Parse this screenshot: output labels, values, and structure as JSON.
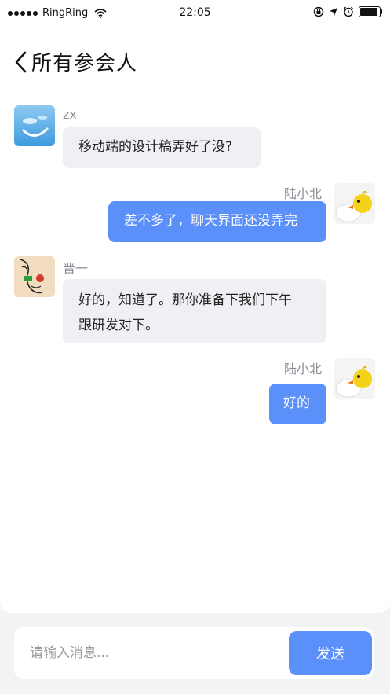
{
  "status_bar": {
    "carrier": "RingRing",
    "time": "22:05",
    "icons": [
      "signal-dots-icon",
      "wifi-icon",
      "rotation-lock-icon",
      "location-arrow-icon",
      "alarm-icon",
      "battery-icon"
    ]
  },
  "header": {
    "back_icon": "chevron-left-icon",
    "title": "所有参会人"
  },
  "messages": [
    {
      "sender": "zx",
      "direction": "incoming",
      "text": "移动端的设计稿弄好了没?",
      "avatar": "sky-smile-avatar"
    },
    {
      "sender": "陆小北",
      "direction": "outgoing",
      "text": "差不多了，聊天界面还没弄完",
      "avatar": "chick-avatar"
    },
    {
      "sender": "晋一",
      "direction": "incoming",
      "text_line1": "好的，知道了。那你准备下我们下午",
      "text_line2": "跟研发对下。",
      "avatar": "sketch-face-avatar"
    },
    {
      "sender": "陆小北",
      "direction": "outgoing",
      "text": "好的",
      "avatar": "chick-avatar"
    }
  ],
  "composer": {
    "placeholder": "请输入消息...",
    "send_label": "发送"
  },
  "colors": {
    "accent": "#5b8ff9",
    "incoming_bubble": "#eef0f4",
    "page_background": "#f2f3f5"
  }
}
